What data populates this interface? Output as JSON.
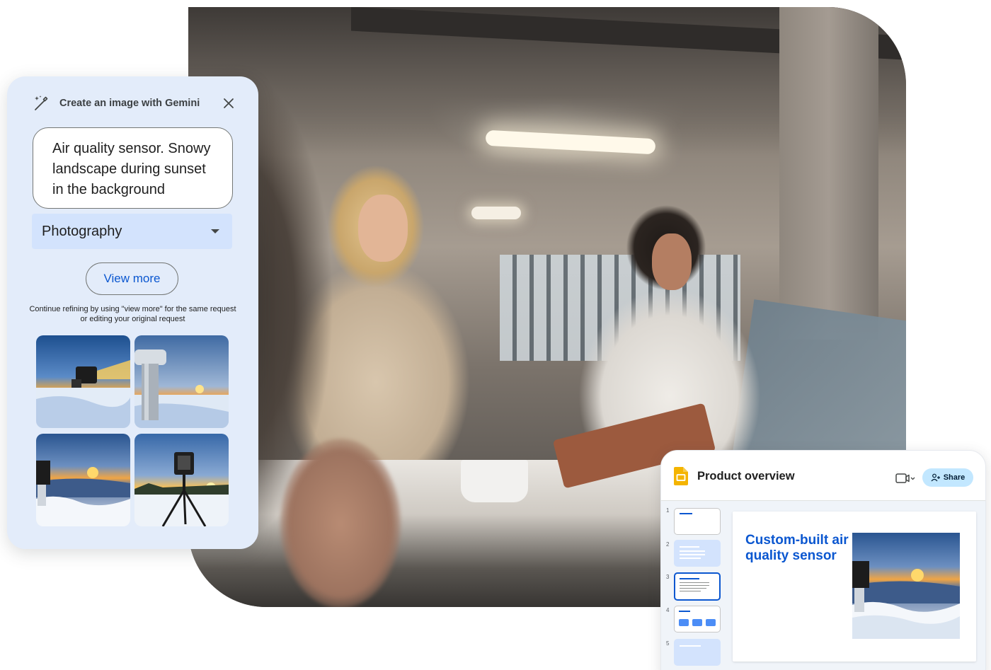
{
  "gemini_panel": {
    "title": "Create an image with Gemini",
    "prompt": "Air quality sensor. Snowy landscape during sunset in the background",
    "style_value": "Photography",
    "view_more_label": "View more",
    "hint": "Continue refining by using \"view more\" for the same request or editing your original request",
    "images": [
      "sensor-snow-sunset-1",
      "sensor-snow-sunset-2",
      "sensor-snow-sunset-3",
      "sensor-snow-sunset-4"
    ]
  },
  "slides": {
    "doc_title": "Product overview",
    "share_label": "Share",
    "slide_numbers": [
      "1",
      "2",
      "3",
      "4",
      "5"
    ],
    "selected_slide": 3,
    "main_heading": "Custom-built air quality sensor"
  },
  "icons": {
    "magic_wand": "wand-sparkle-icon",
    "close": "close-icon",
    "dropdown": "caret-down-icon",
    "slides_logo": "slides-logo-icon",
    "camera": "video-camera-icon",
    "share": "person-add-icon"
  },
  "colors": {
    "gemini_panel_bg": "#e3ecfa",
    "select_bg": "#d3e3fd",
    "accent_blue": "#0b57d0",
    "share_bg": "#c2e7ff",
    "slides_yellow": "#f4b400"
  }
}
